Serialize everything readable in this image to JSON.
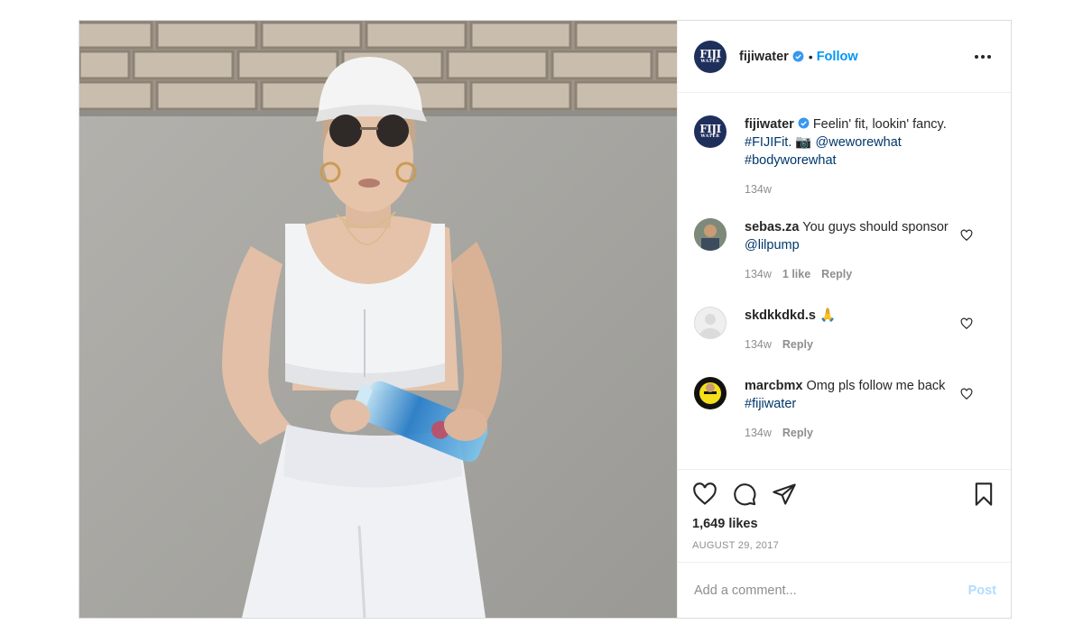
{
  "account": {
    "username": "fijiwater",
    "avatar_text": "FIJI",
    "avatar_subtext": "WATER",
    "separator": "•",
    "follow_label": "Follow"
  },
  "caption": {
    "username": "fijiwater",
    "text": " Feelin' fit, lookin' fancy.",
    "hashtag1": "#FIJIFit.",
    "camera_emoji": "📷",
    "mention": "@weworewhat",
    "hashtag2": "#bodyworewhat",
    "time": "134w"
  },
  "comments": [
    {
      "username": "sebas.za",
      "text": " You guys should sponsor ",
      "mention": "@lilpump",
      "time": "134w",
      "likes": "1 like",
      "reply": "Reply"
    },
    {
      "username": "skdkkdkd.s",
      "text": " 🙏",
      "time": "134w",
      "reply": "Reply"
    },
    {
      "username": "marcbmx",
      "text": " Omg pls follow me back ",
      "hashtag": "#fijiwater",
      "time": "134w",
      "reply": "Reply"
    }
  ],
  "actions": {
    "likes": "1,649 likes",
    "date": "AUGUST 29, 2017"
  },
  "comment_box": {
    "placeholder": "Add a comment...",
    "post_label": "Post"
  },
  "colors": {
    "accent": "#0095f6",
    "link": "#00376b",
    "muted": "#8e8e8e",
    "brand": "#1f2f5c"
  }
}
